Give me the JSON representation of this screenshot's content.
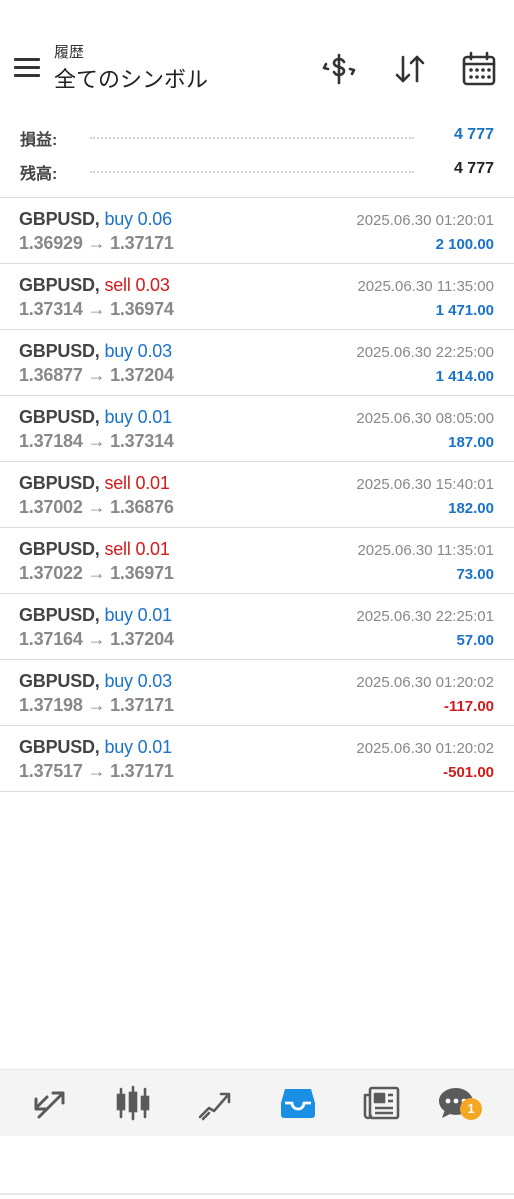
{
  "header": {
    "subtitle": "履歴",
    "title": "全てのシンボル",
    "icons": [
      "menu-icon",
      "currency-exchange-icon",
      "sort-icon",
      "calendar-icon"
    ]
  },
  "summary": {
    "profit_label": "損益:",
    "profit_value": "4 777",
    "balance_label": "残高:",
    "balance_value": "4 777"
  },
  "colors": {
    "buy": "#1a73c9",
    "sell": "#d11a1a",
    "positive": "#1a73c9",
    "negative": "#d11a1a",
    "accent": "#1a8fe3",
    "badge": "#f5a623"
  },
  "trades": [
    {
      "symbol": "GBPUSD,",
      "side": "buy 0.06",
      "type": "buy",
      "prices": "1.36929 → 1.37171",
      "date": "2025.06.30 01:20:01",
      "profit": "2 100.00",
      "sign": "positive"
    },
    {
      "symbol": "GBPUSD,",
      "side": "sell 0.03",
      "type": "sell",
      "prices": "1.37314 → 1.36974",
      "date": "2025.06.30 11:35:00",
      "profit": "1 471.00",
      "sign": "positive"
    },
    {
      "symbol": "GBPUSD,",
      "side": "buy 0.03",
      "type": "buy",
      "prices": "1.36877 → 1.37204",
      "date": "2025.06.30 22:25:00",
      "profit": "1 414.00",
      "sign": "positive"
    },
    {
      "symbol": "GBPUSD,",
      "side": "buy 0.01",
      "type": "buy",
      "prices": "1.37184 → 1.37314",
      "date": "2025.06.30 08:05:00",
      "profit": "187.00",
      "sign": "positive"
    },
    {
      "symbol": "GBPUSD,",
      "side": "sell 0.01",
      "type": "sell",
      "prices": "1.37002 → 1.36876",
      "date": "2025.06.30 15:40:01",
      "profit": "182.00",
      "sign": "positive"
    },
    {
      "symbol": "GBPUSD,",
      "side": "sell 0.01",
      "type": "sell",
      "prices": "1.37022 → 1.36971",
      "date": "2025.06.30 11:35:01",
      "profit": "73.00",
      "sign": "positive"
    },
    {
      "symbol": "GBPUSD,",
      "side": "buy 0.01",
      "type": "buy",
      "prices": "1.37164 → 1.37204",
      "date": "2025.06.30 22:25:01",
      "profit": "57.00",
      "sign": "positive"
    },
    {
      "symbol": "GBPUSD,",
      "side": "buy 0.03",
      "type": "buy",
      "prices": "1.37198 → 1.37171",
      "date": "2025.06.30 01:20:02",
      "profit": "-117.00",
      "sign": "negative"
    },
    {
      "symbol": "GBPUSD,",
      "side": "buy 0.01",
      "type": "buy",
      "prices": "1.37517 → 1.37171",
      "date": "2025.06.30 01:20:02",
      "profit": "-501.00",
      "sign": "negative"
    }
  ],
  "bottom_nav": {
    "items": [
      "quotes-icon",
      "chart-icon",
      "trade-icon",
      "history-icon",
      "news-icon",
      "chat-icon"
    ],
    "active": "history-icon",
    "chat_badge": "1"
  }
}
